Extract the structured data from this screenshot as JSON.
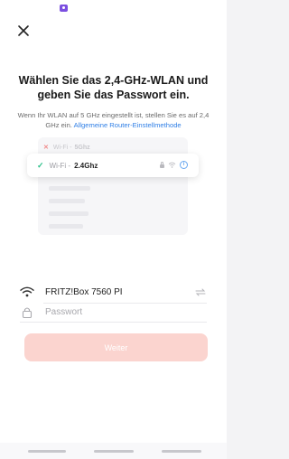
{
  "header": {
    "close_icon": "close-icon",
    "status_icon": "app-badge-icon"
  },
  "title": "Wählen Sie das 2,4-GHz-WLAN und geben Sie das Passwort ein.",
  "description": {
    "text": "Wenn Ihr WLAN auf 5 GHz eingestellt ist, stellen Sie es auf 2,4 GHz ein.",
    "link": "Allgemeine Router-Einstellmethode"
  },
  "illustration": {
    "row_5g": {
      "prefix": "Wi-Fi - ",
      "band": "5Ghz"
    },
    "row_24g": {
      "prefix": "Wi-Fi - ",
      "band": "2.4Ghz"
    }
  },
  "form": {
    "ssid_value": "FRITZ!Box 7560 PI",
    "password_placeholder": "Passwort"
  },
  "next_button": {
    "label": "Weiter",
    "state": "disabled"
  },
  "colors": {
    "accent": "#fbd4cf",
    "link": "#2f7fe6",
    "check": "#2cc08a"
  }
}
